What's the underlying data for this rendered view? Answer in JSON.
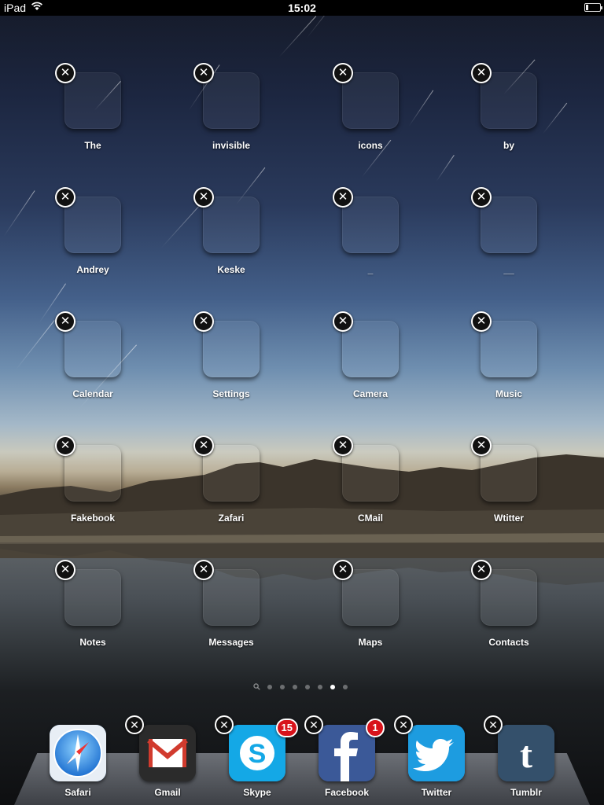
{
  "status_bar": {
    "carrier": "iPad",
    "time": "15:02",
    "wifi_icon": "wifi-icon",
    "battery_icon": "battery-icon"
  },
  "home_grid": {
    "apps": [
      {
        "label": "The"
      },
      {
        "label": "invisible"
      },
      {
        "label": "icons"
      },
      {
        "label": "by"
      },
      {
        "label": "Andrey"
      },
      {
        "label": "Keske"
      },
      {
        "label": "_"
      },
      {
        "label": "__"
      },
      {
        "label": "Calendar"
      },
      {
        "label": "Settings"
      },
      {
        "label": "Camera"
      },
      {
        "label": "Music"
      },
      {
        "label": "Fakebook"
      },
      {
        "label": "Zafari"
      },
      {
        "label": "CMail"
      },
      {
        "label": "Wtitter"
      },
      {
        "label": "Notes"
      },
      {
        "label": "Messages"
      },
      {
        "label": "Maps"
      },
      {
        "label": "Contacts"
      }
    ],
    "delete_glyph": "✕"
  },
  "page_indicator": {
    "pages": 7,
    "active_page": 6,
    "search_page_icon": "search-icon"
  },
  "dock": {
    "apps": [
      {
        "label": "Safari",
        "icon": "compass-icon",
        "color": "#3b8de0"
      },
      {
        "label": "Gmail",
        "icon": "envelope-icon",
        "color": "#2b2b2b"
      },
      {
        "label": "Skype",
        "icon": "skype-icon",
        "color": "#14a8e6",
        "badge": "15"
      },
      {
        "label": "Facebook",
        "icon": "facebook-f-icon",
        "color": "#3b5998",
        "badge": "1"
      },
      {
        "label": "Twitter",
        "icon": "bird-icon",
        "color": "#1d9ce0"
      },
      {
        "label": "Tumblr",
        "icon": "tumblr-t-icon",
        "color": "#34506b"
      }
    ]
  }
}
